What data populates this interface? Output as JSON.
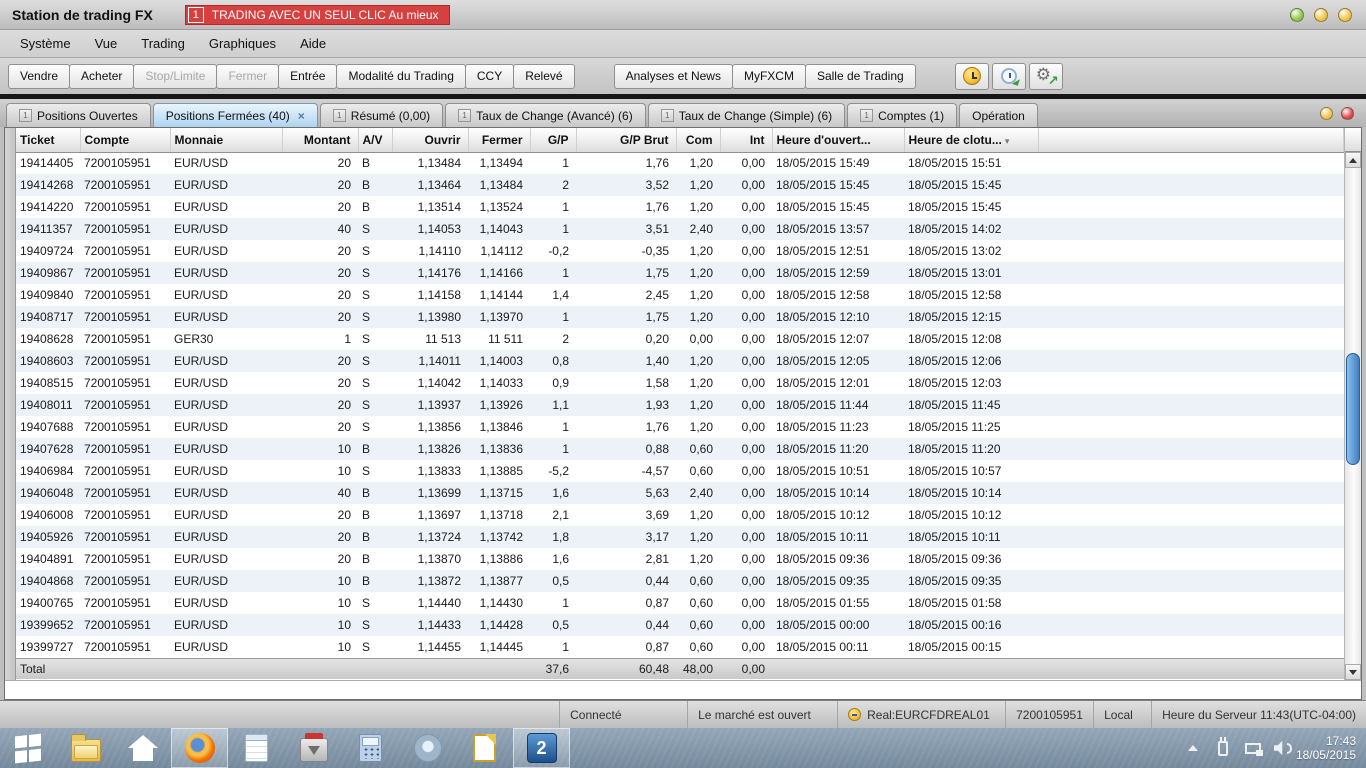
{
  "window": {
    "title": "Station de trading FX",
    "banner_badge": "1",
    "banner_text": "TRADING AVEC UN SEUL CLIC Au mieux",
    "button_colors": [
      "#8dc63f",
      "#f2c23e",
      "#f2c23e"
    ]
  },
  "menu": {
    "items": [
      "Système",
      "Vue",
      "Trading",
      "Graphiques",
      "Aide"
    ]
  },
  "toolbar": {
    "trade_buttons": [
      {
        "label": "Vendre",
        "enabled": true
      },
      {
        "label": "Acheter",
        "enabled": true
      },
      {
        "label": "Stop/Limite",
        "enabled": false
      },
      {
        "label": "Fermer",
        "enabled": false
      },
      {
        "label": "Entrée",
        "enabled": true
      },
      {
        "label": "Modalité du Trading",
        "enabled": true
      },
      {
        "label": "CCY",
        "enabled": true
      },
      {
        "label": "Relevé",
        "enabled": true
      }
    ],
    "app_buttons": [
      "Analyses et News",
      "MyFXCM",
      "Salle de Trading"
    ],
    "icon_buttons": [
      "server-clock-icon",
      "history-clock-icon",
      "settings-sync-icon"
    ]
  },
  "tabs": {
    "icon_glyph": "1",
    "button_colors": [
      "#f2c23e",
      "#e04545"
    ],
    "items": [
      {
        "label": "Positions Ouvertes",
        "icon": true,
        "active": false
      },
      {
        "label": "Positions Fermées (40)",
        "icon": false,
        "active": true,
        "close": "×"
      },
      {
        "label": "Résumé (0,00)",
        "icon": true,
        "active": false
      },
      {
        "label": "Taux de Change (Avancé) (6)",
        "icon": true,
        "active": false
      },
      {
        "label": "Taux de Change (Simple) (6)",
        "icon": true,
        "active": false
      },
      {
        "label": "Comptes (1)",
        "icon": true,
        "active": false
      },
      {
        "label": "Opération",
        "icon": false,
        "active": false
      }
    ]
  },
  "table": {
    "columns": [
      {
        "label": "Ticket",
        "align": "l"
      },
      {
        "label": "Compte",
        "align": "l"
      },
      {
        "label": "Monnaie",
        "align": "l"
      },
      {
        "label": "Montant",
        "align": "r"
      },
      {
        "label": "A/V",
        "align": "l"
      },
      {
        "label": "Ouvrir",
        "align": "r"
      },
      {
        "label": "Fermer",
        "align": "r"
      },
      {
        "label": "G/P",
        "align": "r"
      },
      {
        "label": "G/P Brut",
        "align": "r"
      },
      {
        "label": "Com",
        "align": "r"
      },
      {
        "label": "Int",
        "align": "r"
      },
      {
        "label": "Heure d'ouvert...",
        "align": "l"
      },
      {
        "label": "Heure de clotu...",
        "align": "l"
      }
    ],
    "sort_column": "Heure de clotu...",
    "rows": [
      [
        "19414405",
        "7200105951",
        "EUR/USD",
        "20",
        "B",
        "1,13484",
        "1,13494",
        "1",
        "1,76",
        "1,20",
        "0,00",
        "18/05/2015 15:49",
        "18/05/2015 15:51"
      ],
      [
        "19414268",
        "7200105951",
        "EUR/USD",
        "20",
        "B",
        "1,13464",
        "1,13484",
        "2",
        "3,52",
        "1,20",
        "0,00",
        "18/05/2015 15:45",
        "18/05/2015 15:45"
      ],
      [
        "19414220",
        "7200105951",
        "EUR/USD",
        "20",
        "B",
        "1,13514",
        "1,13524",
        "1",
        "1,76",
        "1,20",
        "0,00",
        "18/05/2015 15:45",
        "18/05/2015 15:45"
      ],
      [
        "19411357",
        "7200105951",
        "EUR/USD",
        "40",
        "S",
        "1,14053",
        "1,14043",
        "1",
        "3,51",
        "2,40",
        "0,00",
        "18/05/2015 13:57",
        "18/05/2015 14:02"
      ],
      [
        "19409724",
        "7200105951",
        "EUR/USD",
        "20",
        "S",
        "1,14110",
        "1,14112",
        "-0,2",
        "-0,35",
        "1,20",
        "0,00",
        "18/05/2015 12:51",
        "18/05/2015 13:02"
      ],
      [
        "19409867",
        "7200105951",
        "EUR/USD",
        "20",
        "S",
        "1,14176",
        "1,14166",
        "1",
        "1,75",
        "1,20",
        "0,00",
        "18/05/2015 12:59",
        "18/05/2015 13:01"
      ],
      [
        "19409840",
        "7200105951",
        "EUR/USD",
        "20",
        "S",
        "1,14158",
        "1,14144",
        "1,4",
        "2,45",
        "1,20",
        "0,00",
        "18/05/2015 12:58",
        "18/05/2015 12:58"
      ],
      [
        "19408717",
        "7200105951",
        "EUR/USD",
        "20",
        "S",
        "1,13980",
        "1,13970",
        "1",
        "1,75",
        "1,20",
        "0,00",
        "18/05/2015 12:10",
        "18/05/2015 12:15"
      ],
      [
        "19408628",
        "7200105951",
        "GER30",
        "1",
        "S",
        "11 513",
        "11 511",
        "2",
        "0,20",
        "0,00",
        "0,00",
        "18/05/2015 12:07",
        "18/05/2015 12:08"
      ],
      [
        "19408603",
        "7200105951",
        "EUR/USD",
        "20",
        "S",
        "1,14011",
        "1,14003",
        "0,8",
        "1,40",
        "1,20",
        "0,00",
        "18/05/2015 12:05",
        "18/05/2015 12:06"
      ],
      [
        "19408515",
        "7200105951",
        "EUR/USD",
        "20",
        "S",
        "1,14042",
        "1,14033",
        "0,9",
        "1,58",
        "1,20",
        "0,00",
        "18/05/2015 12:01",
        "18/05/2015 12:03"
      ],
      [
        "19408011",
        "7200105951",
        "EUR/USD",
        "20",
        "S",
        "1,13937",
        "1,13926",
        "1,1",
        "1,93",
        "1,20",
        "0,00",
        "18/05/2015 11:44",
        "18/05/2015 11:45"
      ],
      [
        "19407688",
        "7200105951",
        "EUR/USD",
        "20",
        "S",
        "1,13856",
        "1,13846",
        "1",
        "1,76",
        "1,20",
        "0,00",
        "18/05/2015 11:23",
        "18/05/2015 11:25"
      ],
      [
        "19407628",
        "7200105951",
        "EUR/USD",
        "10",
        "B",
        "1,13826",
        "1,13836",
        "1",
        "0,88",
        "0,60",
        "0,00",
        "18/05/2015 11:20",
        "18/05/2015 11:20"
      ],
      [
        "19406984",
        "7200105951",
        "EUR/USD",
        "10",
        "S",
        "1,13833",
        "1,13885",
        "-5,2",
        "-4,57",
        "0,60",
        "0,00",
        "18/05/2015 10:51",
        "18/05/2015 10:57"
      ],
      [
        "19406048",
        "7200105951",
        "EUR/USD",
        "40",
        "B",
        "1,13699",
        "1,13715",
        "1,6",
        "5,63",
        "2,40",
        "0,00",
        "18/05/2015 10:14",
        "18/05/2015 10:14"
      ],
      [
        "19406008",
        "7200105951",
        "EUR/USD",
        "20",
        "B",
        "1,13697",
        "1,13718",
        "2,1",
        "3,69",
        "1,20",
        "0,00",
        "18/05/2015 10:12",
        "18/05/2015 10:12"
      ],
      [
        "19405926",
        "7200105951",
        "EUR/USD",
        "20",
        "B",
        "1,13724",
        "1,13742",
        "1,8",
        "3,17",
        "1,20",
        "0,00",
        "18/05/2015 10:11",
        "18/05/2015 10:11"
      ],
      [
        "19404891",
        "7200105951",
        "EUR/USD",
        "20",
        "B",
        "1,13870",
        "1,13886",
        "1,6",
        "2,81",
        "1,20",
        "0,00",
        "18/05/2015 09:36",
        "18/05/2015 09:36"
      ],
      [
        "19404868",
        "7200105951",
        "EUR/USD",
        "10",
        "B",
        "1,13872",
        "1,13877",
        "0,5",
        "0,44",
        "0,60",
        "0,00",
        "18/05/2015 09:35",
        "18/05/2015 09:35"
      ],
      [
        "19400765",
        "7200105951",
        "EUR/USD",
        "10",
        "S",
        "1,14440",
        "1,14430",
        "1",
        "0,87",
        "0,60",
        "0,00",
        "18/05/2015 01:55",
        "18/05/2015 01:58"
      ],
      [
        "19399652",
        "7200105951",
        "EUR/USD",
        "10",
        "S",
        "1,14433",
        "1,14428",
        "0,5",
        "0,44",
        "0,60",
        "0,00",
        "18/05/2015 00:00",
        "18/05/2015 00:16"
      ],
      [
        "19399727",
        "7200105951",
        "EUR/USD",
        "10",
        "S",
        "1,14455",
        "1,14445",
        "1",
        "0,87",
        "0,60",
        "0,00",
        "18/05/2015 00:11",
        "18/05/2015 00:15"
      ]
    ],
    "total": {
      "label": "Total",
      "gp": "37,6",
      "gp_brut": "60,48",
      "com": "48,00",
      "int": "0,00"
    }
  },
  "status_bar": {
    "items": [
      {
        "name": "connection-status",
        "text": "Connecté"
      },
      {
        "name": "market-status",
        "text": "Le marché est ouvert"
      },
      {
        "name": "account-server",
        "text": "Real:EURCFDREAL01",
        "icon": true
      },
      {
        "name": "account-number",
        "text": "7200105951"
      },
      {
        "name": "time-mode",
        "text": "Local"
      },
      {
        "name": "server-time",
        "text": "Heure du Serveur 11:43(UTC-04:00)"
      }
    ]
  },
  "taskbar": {
    "icons": [
      {
        "name": "start-icon"
      },
      {
        "name": "file-explorer-icon"
      },
      {
        "name": "home-icon"
      },
      {
        "name": "firefox-icon",
        "active": true
      },
      {
        "name": "notepad-icon"
      },
      {
        "name": "install-tool-icon"
      },
      {
        "name": "calculator-icon"
      },
      {
        "name": "chromium-icon"
      },
      {
        "name": "libreoffice-icon"
      },
      {
        "name": "trading-station-icon",
        "active": true,
        "glyph": "2"
      }
    ],
    "tray": [
      "chevron-up-icon",
      "power-plug-icon",
      "network-icon",
      "volume-icon"
    ],
    "clock_time": "17:43",
    "clock_date": "18/05/2015"
  }
}
